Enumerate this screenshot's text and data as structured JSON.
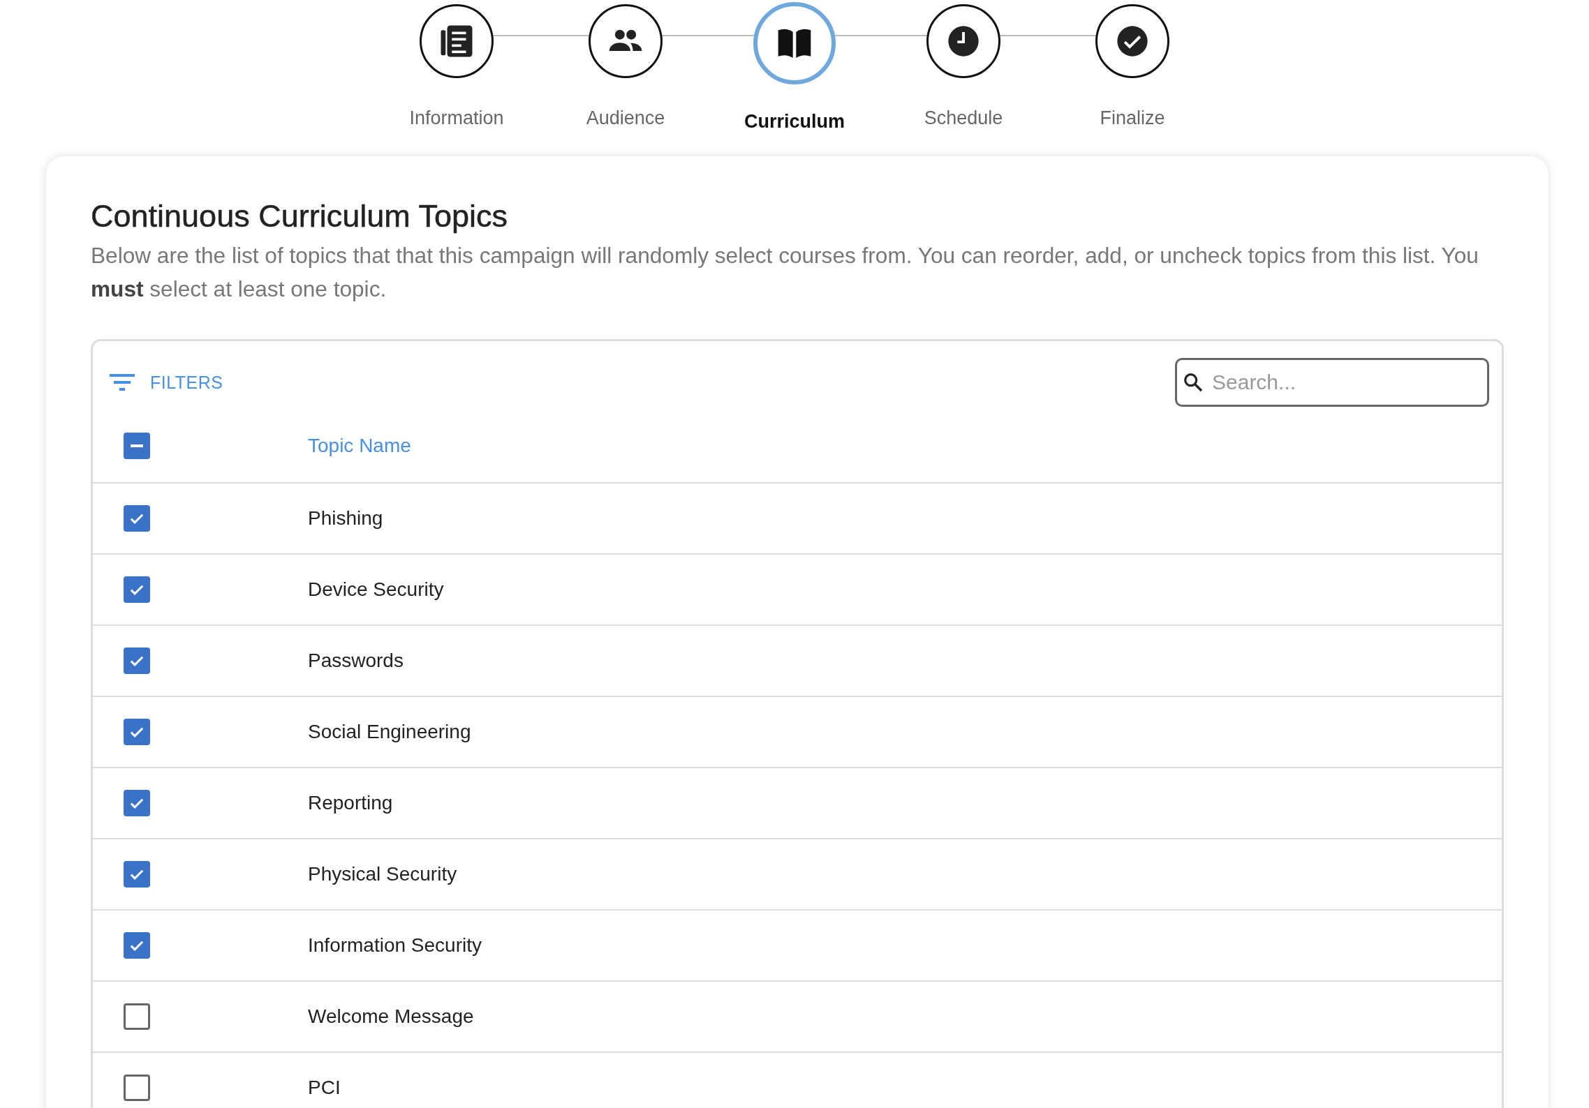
{
  "stepper": [
    {
      "label": "Information",
      "selected": false
    },
    {
      "label": "Audience",
      "selected": false
    },
    {
      "label": "Curriculum",
      "selected": true
    },
    {
      "label": "Schedule",
      "selected": false
    },
    {
      "label": "Finalize",
      "selected": false
    }
  ],
  "card": {
    "title": "Continuous Curriculum Topics",
    "description": "Below are the list of topics that that this campaign will randomly select courses from. You can reorder, add, or uncheck topics from this list. You **must** select at least one topic."
  },
  "table": {
    "filters_label": "FILTERS",
    "search": {
      "placeholder": "Search..."
    },
    "header": {
      "indeterminate": true,
      "column": "Topic Name"
    },
    "rows": [
      {
        "name": "Phishing",
        "checked": true
      },
      {
        "name": "Device Security",
        "checked": true
      },
      {
        "name": "Passwords",
        "checked": true
      },
      {
        "name": "Social Engineering",
        "checked": true
      },
      {
        "name": "Reporting",
        "checked": true
      },
      {
        "name": "Physical Security",
        "checked": true
      },
      {
        "name": "Information Security",
        "checked": true
      },
      {
        "name": "Welcome Message",
        "checked": false
      },
      {
        "name": "PCI",
        "checked": false
      }
    ]
  }
}
